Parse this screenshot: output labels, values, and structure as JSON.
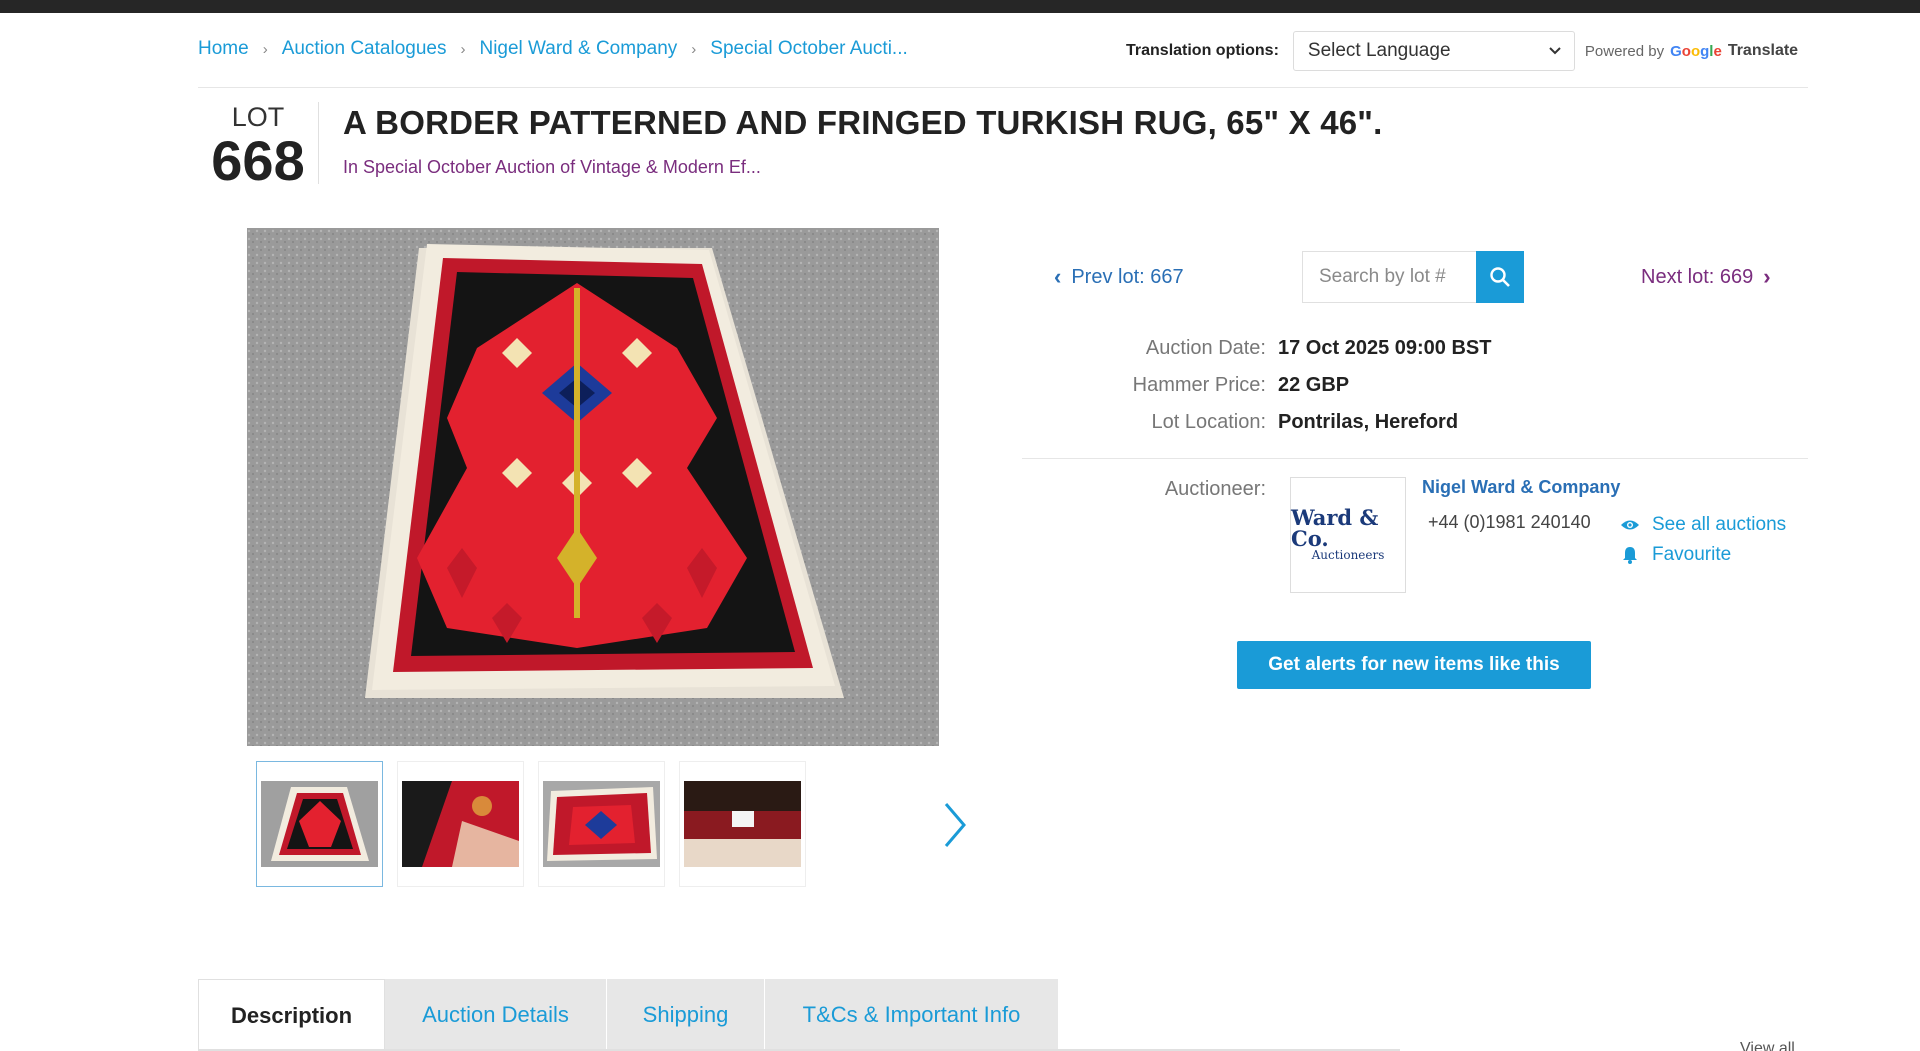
{
  "breadcrumb": {
    "items": [
      "Home",
      "Auction Catalogues",
      "Nigel Ward & Company",
      "Special October Aucti..."
    ]
  },
  "translation": {
    "label": "Translation options:",
    "select_value": "Select Language",
    "powered_by": "Powered by",
    "google": [
      "G",
      "o",
      "o",
      "g",
      "l",
      "e"
    ],
    "translate": "Translate"
  },
  "lot": {
    "word": "LOT",
    "number": "668",
    "title": "A BORDER PATTERNED AND FRINGED TURKISH RUG, 65\" X 46\".",
    "subtitle": "In Special October Auction of Vintage & Modern Ef..."
  },
  "navigation": {
    "prev": "Prev lot: 667",
    "next": "Next lot: 669",
    "search_placeholder": "Search by lot #"
  },
  "details": {
    "auction_date_label": "Auction Date:",
    "auction_date": "17 Oct 2025 09:00 BST",
    "hammer_label": "Hammer Price:",
    "hammer_price": "22 GBP",
    "location_label": "Lot Location:",
    "location": "Pontrilas, Hereford"
  },
  "auctioneer": {
    "label": "Auctioneer:",
    "name": "Nigel Ward & Company",
    "phone": "+44 (0)1981 240140",
    "see_all": "See all auctions",
    "favourite": "Favourite",
    "logo_line1": "Ward & Co.",
    "logo_line2": "Auctioneers"
  },
  "alert_button": "Get alerts for new items like this",
  "tabs": [
    "Description",
    "Auction Details",
    "Shipping",
    "T&Cs & Important Info"
  ],
  "view_all": "View all",
  "colors": {
    "link_blue": "#1a9bd7",
    "purple": "#7a2d7e",
    "rug_red": "#d8202c"
  }
}
